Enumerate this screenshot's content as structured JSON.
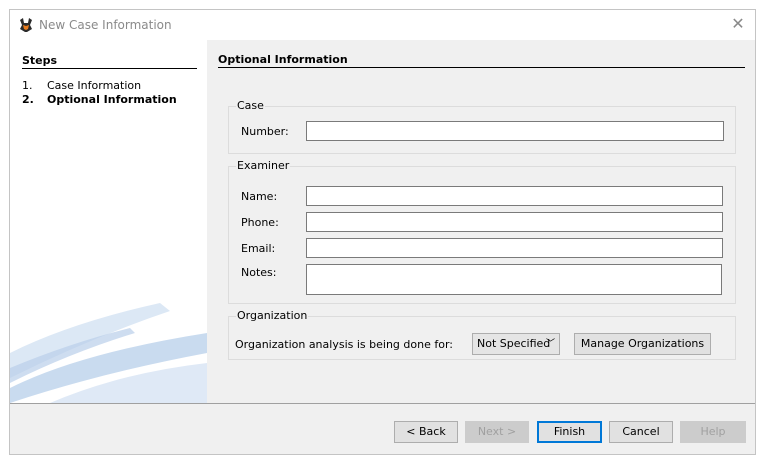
{
  "window": {
    "title": "New Case Information"
  },
  "steps": {
    "title": "Steps",
    "items": [
      {
        "num": "1.",
        "label": "Case Information"
      },
      {
        "num": "2.",
        "label": "Optional Information"
      }
    ]
  },
  "panel": {
    "title": "Optional Information"
  },
  "case_group": {
    "legend": "Case",
    "number_label": "Number:",
    "number_value": ""
  },
  "examiner_group": {
    "legend": "Examiner",
    "name_label": "Name:",
    "phone_label": "Phone:",
    "email_label": "Email:",
    "notes_label": "Notes:",
    "name_value": "",
    "phone_value": "",
    "email_value": "",
    "notes_value": ""
  },
  "organization_group": {
    "legend": "Organization",
    "analysis_label": "Organization analysis is being done for:",
    "selected_org": "Not Specified",
    "manage_button": "Manage Organizations"
  },
  "buttons": {
    "back": "< Back",
    "next": "Next >",
    "finish": "Finish",
    "cancel": "Cancel",
    "help": "Help"
  }
}
